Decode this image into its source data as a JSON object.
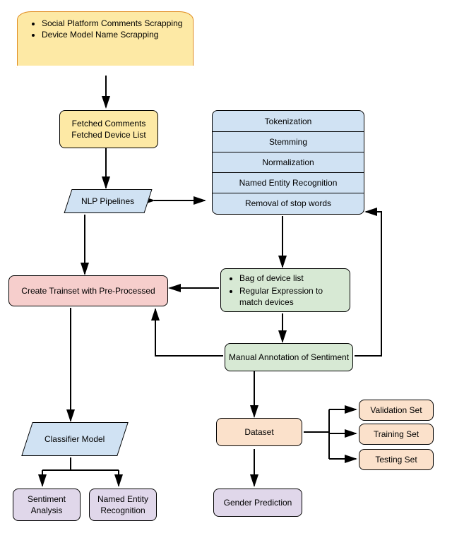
{
  "input": {
    "items": [
      "Social Platform Comments Scrapping",
      "Device Model Name Scrapping"
    ]
  },
  "fetched": {
    "line1": "Fetched Comments",
    "line2": "Fetched Device List"
  },
  "nlp_label": "NLP Pipelines",
  "nlp_steps": [
    "Tokenization",
    "Stemming",
    "Normalization",
    "Named Entity Recognition",
    "Removal of stop words"
  ],
  "create_trainset": "Create Trainset with Pre-Processed",
  "bag_box": {
    "items": [
      "Bag of device list",
      "Regular Expression to match devices"
    ]
  },
  "manual_annot": "Manual Annotation of Sentiment",
  "classifier": "Classifier Model",
  "dataset": "Dataset",
  "outputs_left": {
    "sentiment": "Sentiment Analysis",
    "ner": "Named Entity Recognition"
  },
  "gender": "Gender Prediction",
  "dataset_splits": {
    "validation": "Validation Set",
    "training": "Training Set",
    "testing": "Testing Set"
  }
}
